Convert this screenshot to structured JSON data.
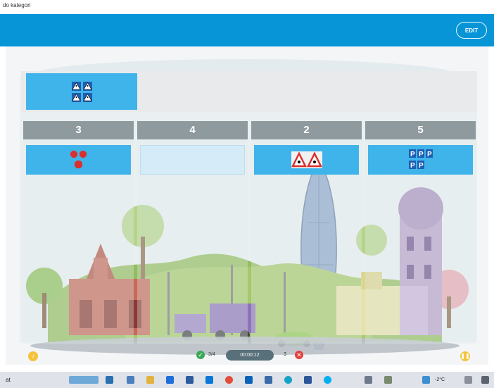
{
  "window": {
    "title": "do kategori"
  },
  "topbar": {
    "edit_label": "EDIT"
  },
  "columns": [
    {
      "number": "3",
      "sign_type": "stop-signs",
      "filled": true
    },
    {
      "number": "4",
      "sign_type": "",
      "filled": false
    },
    {
      "number": "2",
      "sign_type": "warning-triangle-signs",
      "filled": true
    },
    {
      "number": "5",
      "sign_type": "parking-signs",
      "filled": true
    }
  ],
  "source_card": {
    "sign_type": "pedestrian-crossing-signs"
  },
  "game_controls": {
    "correct_count": "3/4",
    "timer": "00:00:12",
    "wrong_count": "3"
  },
  "taskbar": {
    "left_text": "at",
    "temperature": "-2°C"
  },
  "colors": {
    "topbar": "#0795d8",
    "card": "#3fb4ea",
    "column_header": "#8e9a9d",
    "correct": "#3aa857",
    "wrong": "#e23f3f"
  }
}
